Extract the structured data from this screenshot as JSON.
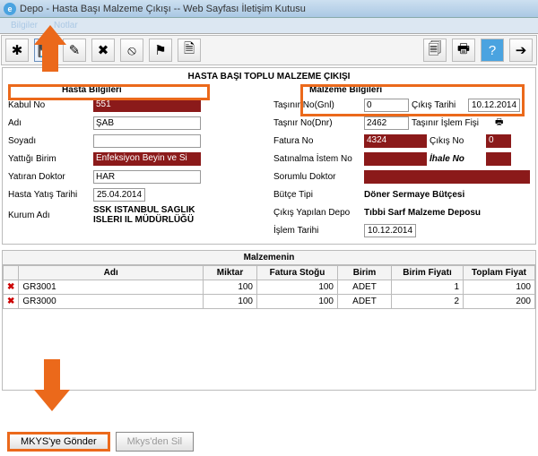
{
  "window": {
    "title": "Depo - Hasta Başı Malzeme Çıkışı -- Web Sayfası İletişim Kutusu"
  },
  "tabs": {
    "t0": "Bilgiler",
    "t1": "Notlar"
  },
  "toolbar": {
    "new": "✱",
    "save": "💾",
    "edit": "✎",
    "delete": "✖",
    "forbid": "⦸",
    "flag": "⚑",
    "doc": "🗎",
    "copy": "🗐",
    "print": "🖶",
    "help": "?",
    "exit": "➔"
  },
  "formTitle": "HASTA BAŞI TOPLU MALZEME ÇIKIŞI",
  "sections": {
    "left": "Hasta Bilgileri",
    "right": "Malzeme Bilgileri"
  },
  "patient": {
    "kabulNo_label": "Kabul No",
    "kabulNo": "551",
    "adi_label": "Adı",
    "adi": "ŞAB",
    "soyadi_label": "Soyadı",
    "soyadi": "",
    "birim_label": "Yattığı Birim",
    "birim": "Enfeksiyon Beyin ve Si",
    "doktor_label": "Yatıran Doktor",
    "doktor": "HAR",
    "yatis_label": "Hasta Yatış Tarihi",
    "yatis": "25.04.2014",
    "kurum_label": "Kurum Adı",
    "kurum": "SSK ISTANBUL SAGLIK ISLERI IL MÜDÜRLÜĞÜ"
  },
  "material": {
    "gnl_label": "Taşınır No(Gnl)",
    "gnl": "0",
    "cikisTarih_label": "Çıkış Tarihi",
    "cikisTarih": "10.12.2014",
    "dnr_label": "Taşnır No(Dnr)",
    "dnr": "2462",
    "islemFisi_label": "Taşınır İşlem Fişi",
    "faturaNo_label": "Fatura No",
    "faturaNo": "4324",
    "cikisNo_label": "Çıkış No",
    "cikisNo": "0",
    "satinalma_label": "Satınalma İstem No",
    "satinalma": "",
    "ihale_label": "İhale No",
    "ihale": "",
    "sorumlu_label": "Sorumlu Doktor",
    "sorumlu": "",
    "butce_label": "Bütçe Tipi",
    "butce": "Döner Sermaye Bütçesi",
    "depo_label": "Çıkış Yapılan Depo",
    "depo": "Tıbbi Sarf Malzeme Deposu",
    "islemTarih_label": "İşlem Tarihi",
    "islemTarih": "10.12.2014"
  },
  "grid": {
    "header": "Malzemenin",
    "cols": {
      "adi": "Adı",
      "miktar": "Miktar",
      "stogu": "Fatura Stoğu",
      "birim": "Birim",
      "fiyat": "Birim Fiyatı",
      "toplam": "Toplam Fiyat"
    },
    "rows": [
      {
        "adi": "GR3001",
        "miktar": 100,
        "stogu": 100,
        "birim": "ADET",
        "fiyat": 1,
        "toplam": 100
      },
      {
        "adi": "GR3000",
        "miktar": 100,
        "stogu": 100,
        "birim": "ADET",
        "fiyat": 2,
        "toplam": 200
      }
    ]
  },
  "buttons": {
    "send": "MKYS'ye Gönder",
    "del": "Mkys'den Sil"
  }
}
